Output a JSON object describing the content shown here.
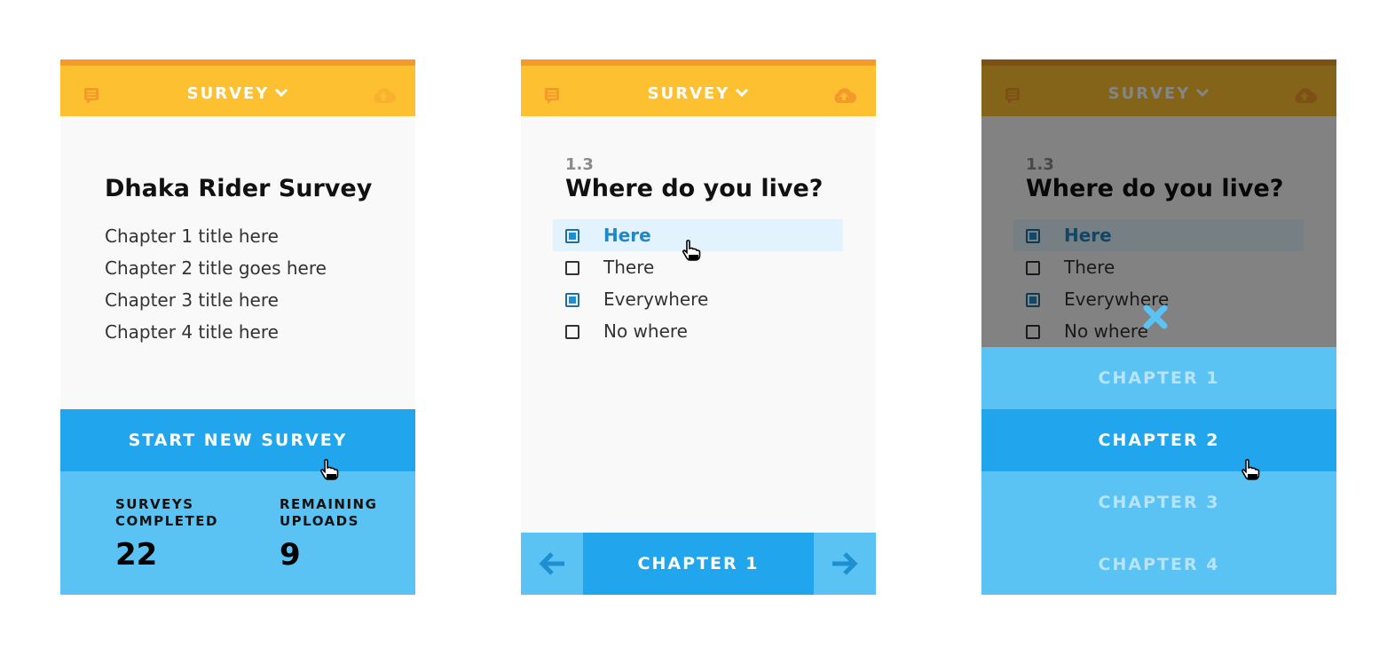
{
  "header": {
    "title": "SURVEY",
    "notes_icon": "notes-icon",
    "upload_icon": "cloud-upload-icon"
  },
  "colors": {
    "header_bg": "#fdc030",
    "header_accent": "#f39a2b",
    "primary": "#21a6ee",
    "secondary": "#5bc3f3"
  },
  "home": {
    "survey_name": "Dhaka Rider Survey",
    "chapters": [
      "Chapter 1 title here",
      "Chapter 2 title goes here",
      "Chapter 3 title here",
      "Chapter 4 title here"
    ],
    "start_button": "START NEW SURVEY",
    "stats": [
      {
        "label": "SURVEYS COMPLETED",
        "value": "22"
      },
      {
        "label": "REMAINING UPLOADS",
        "value": "9"
      }
    ]
  },
  "question": {
    "number": "1.3",
    "title": "Where do you live?",
    "options": [
      {
        "label": "Here",
        "checked": true,
        "highlighted": true
      },
      {
        "label": "There",
        "checked": false,
        "highlighted": false
      },
      {
        "label": "Everywhere",
        "checked": true,
        "highlighted": false
      },
      {
        "label": "No where",
        "checked": false,
        "highlighted": false
      }
    ],
    "chapter_label": "CHAPTER 1"
  },
  "chapter_picker": {
    "chapters": [
      "CHAPTER 1",
      "CHAPTER 2",
      "CHAPTER 3",
      "CHAPTER 4"
    ],
    "active_index": 1
  }
}
